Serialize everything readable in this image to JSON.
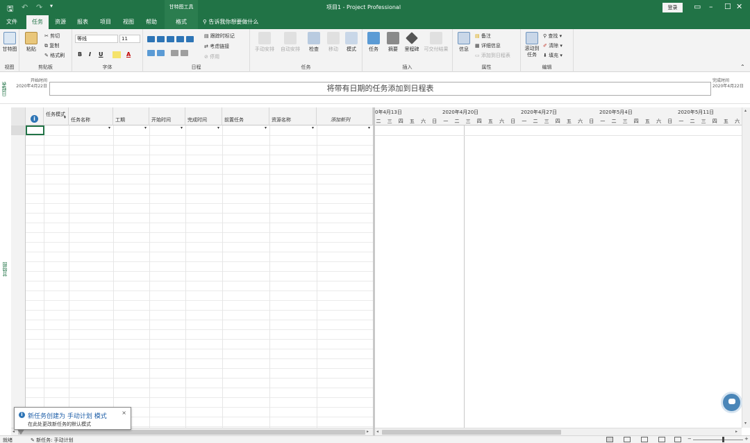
{
  "app": {
    "title": "项目1 - Project Professional",
    "context_tab_header": "甘特图工具",
    "signin": "登录"
  },
  "tabs": [
    "文件",
    "任务",
    "资源",
    "报表",
    "项目",
    "视图",
    "帮助",
    "格式"
  ],
  "tell_me": "告诉我你想要做什么",
  "ribbon": {
    "view": {
      "label": "视图",
      "gantt_btn": "甘特图"
    },
    "clipboard": {
      "label": "剪贴板",
      "paste": "粘贴",
      "cut": "剪切",
      "copy": "复制",
      "format_painter": "格式刷"
    },
    "font": {
      "label": "字体",
      "family": "等线",
      "size": "11",
      "bold": "B",
      "italic": "I",
      "underline": "U",
      "color_a": "A"
    },
    "schedule": {
      "label": "日程",
      "mark_on_track": "跟踪时标记",
      "respect_links": "考虑链接",
      "inactivate": "停用",
      "percents": [
        "0%",
        "25%",
        "50%",
        "75%",
        "100%"
      ]
    },
    "tasks": {
      "label": "任务",
      "manual": "手动安排",
      "auto": "自动安排",
      "inspect": "检查",
      "move": "移动",
      "mode": "模式"
    },
    "insert": {
      "label": "插入",
      "task": "任务",
      "summary": "摘要",
      "milestone": "里程碑",
      "deliverable": "可交付结果"
    },
    "properties": {
      "label": "属性",
      "info": "信息",
      "notes": "备注",
      "details": "详细信息",
      "add_timeline": "添加到日程表"
    },
    "editing": {
      "label": "编辑",
      "scroll_to_task": "滚动到任务",
      "find": "查找",
      "clear": "清除",
      "fill": "填充"
    }
  },
  "timeline": {
    "vertical_label": "日程表",
    "start_label": "开始时间",
    "start_date": "2020年4月22日",
    "end_label": "完成时间",
    "end_date": "2020年4月22日",
    "placeholder": "将带有日期的任务添加到日程表"
  },
  "grid": {
    "vertical_label": "甘特图",
    "columns": [
      "任务模式",
      "任务名称",
      "工期",
      "开始时间",
      "完成时间",
      "前置任务",
      "资源名称",
      "添加新列"
    ]
  },
  "chart": {
    "weeks": [
      "0年4月13日",
      "2020年4月20日",
      "2020年4月27日",
      "2020年5月4日",
      "2020年5月11日"
    ],
    "days": [
      "二",
      "三",
      "四",
      "五",
      "六",
      "日",
      "一"
    ]
  },
  "status": {
    "ready": "就绪",
    "new_tasks": "新任务: 手动计划"
  },
  "tooltip": {
    "title": "新任务创建为 手动计划 模式",
    "body": "在此处更改新任务的默认模式",
    "close": "×"
  }
}
